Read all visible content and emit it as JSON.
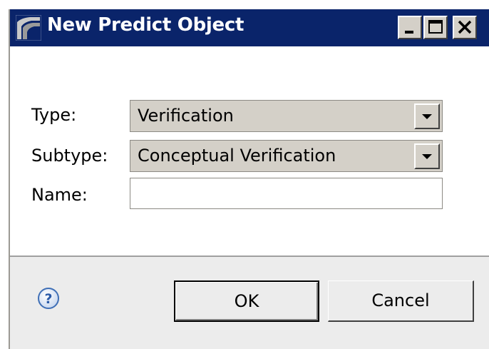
{
  "window": {
    "title": "New Predict Object",
    "controls": {
      "minimize_icon": "minimize-icon",
      "maximize_icon": "maximize-icon",
      "close_icon": "close-icon"
    },
    "titlebar_color": "#0a246a"
  },
  "form": {
    "type_label": "Type:",
    "type_value": "Verification",
    "subtype_label": "Subtype:",
    "subtype_value": "Conceptual Verification",
    "name_label": "Name:",
    "name_value": ""
  },
  "buttons": {
    "help_icon": "help-icon",
    "ok_label": "OK",
    "cancel_label": "Cancel"
  }
}
